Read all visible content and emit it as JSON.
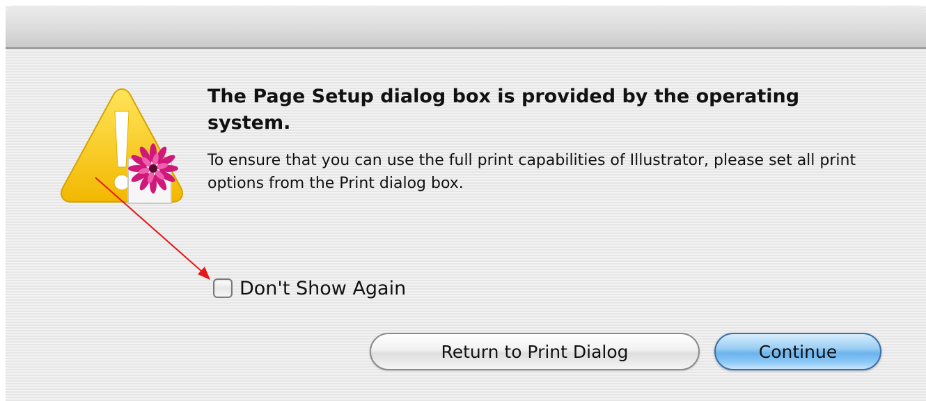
{
  "dialog": {
    "heading": "The Page Setup dialog box is provided by the operating system.",
    "body": "To ensure that you can use the full print capabilities of Illustrator, please set all print options from the Print dialog box.",
    "checkbox": {
      "label": "Don't Show Again",
      "checked": false
    },
    "buttons": {
      "secondary_label": "Return to Print Dialog",
      "primary_label": "Continue"
    }
  },
  "icons": {
    "alert": "caution-triangle-icon",
    "app_badge": "illustrator-flower-icon",
    "annotation": "red-arrow"
  },
  "colors": {
    "warning_yellow": "#f5c400",
    "flower_pink": "#d0187a",
    "primary_button_blue": "#6cb3ee",
    "annotation_red": "#e41818"
  }
}
